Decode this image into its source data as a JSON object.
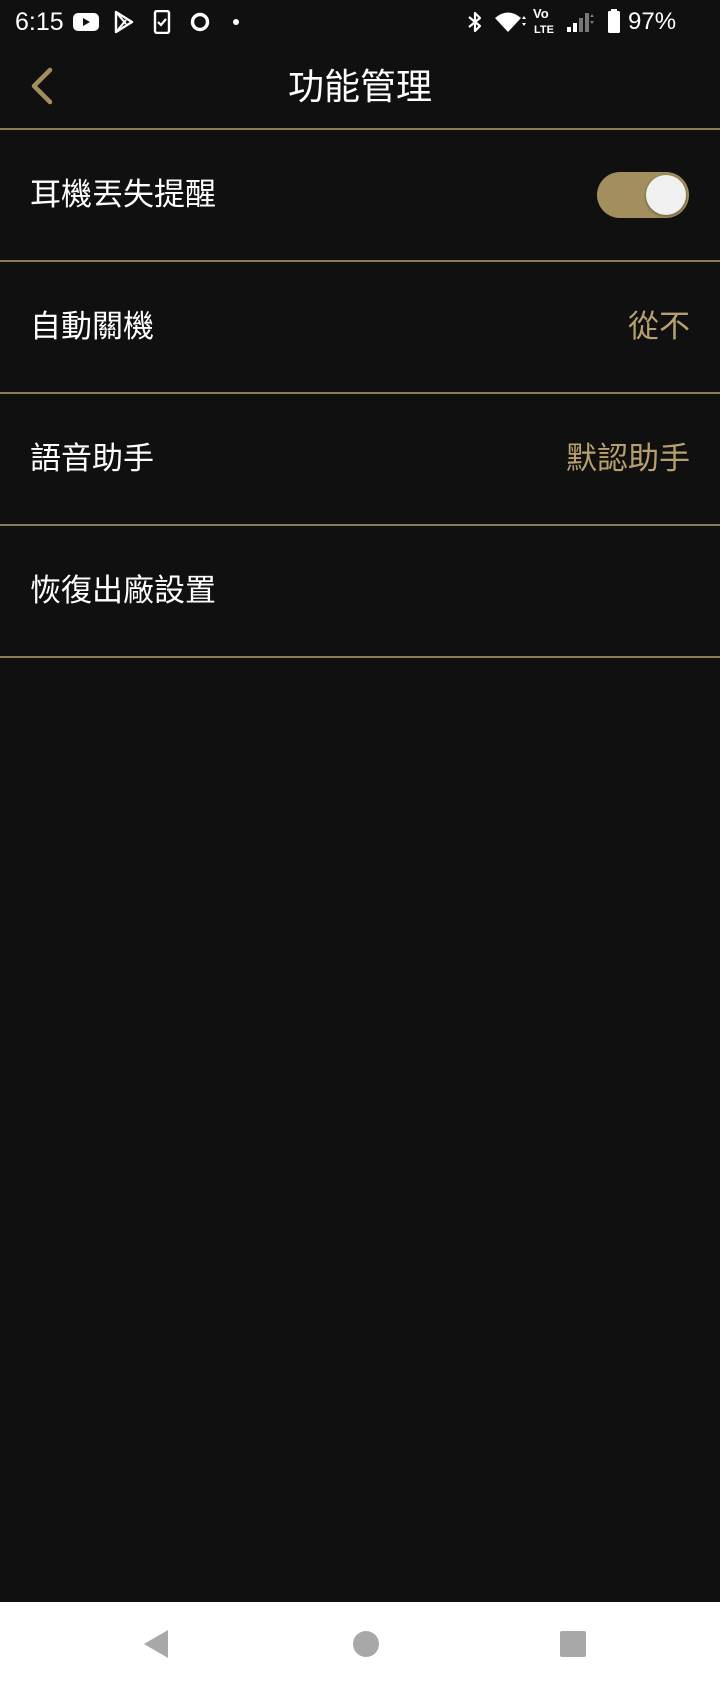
{
  "status_bar": {
    "time": "6:15",
    "battery_percent": "97%",
    "icons": [
      "youtube-icon",
      "play-store-icon",
      "task-icon",
      "circle-icon",
      "dot-icon",
      "bluetooth-icon",
      "wifi-icon",
      "volte-icon",
      "signal-icon",
      "battery-icon"
    ]
  },
  "header": {
    "title": "功能管理",
    "back_icon": "chevron-left-icon"
  },
  "settings": {
    "earphone_loss_alert": {
      "label": "耳機丟失提醒",
      "enabled": true
    },
    "auto_power_off": {
      "label": "自動關機",
      "value": "從不"
    },
    "voice_assistant": {
      "label": "語音助手",
      "value": "默認助手"
    },
    "factory_reset": {
      "label": "恢復出廠設置"
    }
  },
  "nav_bar": {
    "icons": [
      "back-triangle-icon",
      "home-circle-icon",
      "recents-square-icon"
    ]
  },
  "colors": {
    "background": "#101010",
    "accent": "#b6a070",
    "divider": "#8d7c55",
    "toggle_track": "#a38f5e",
    "nav_bar_bg": "#ffffff"
  }
}
